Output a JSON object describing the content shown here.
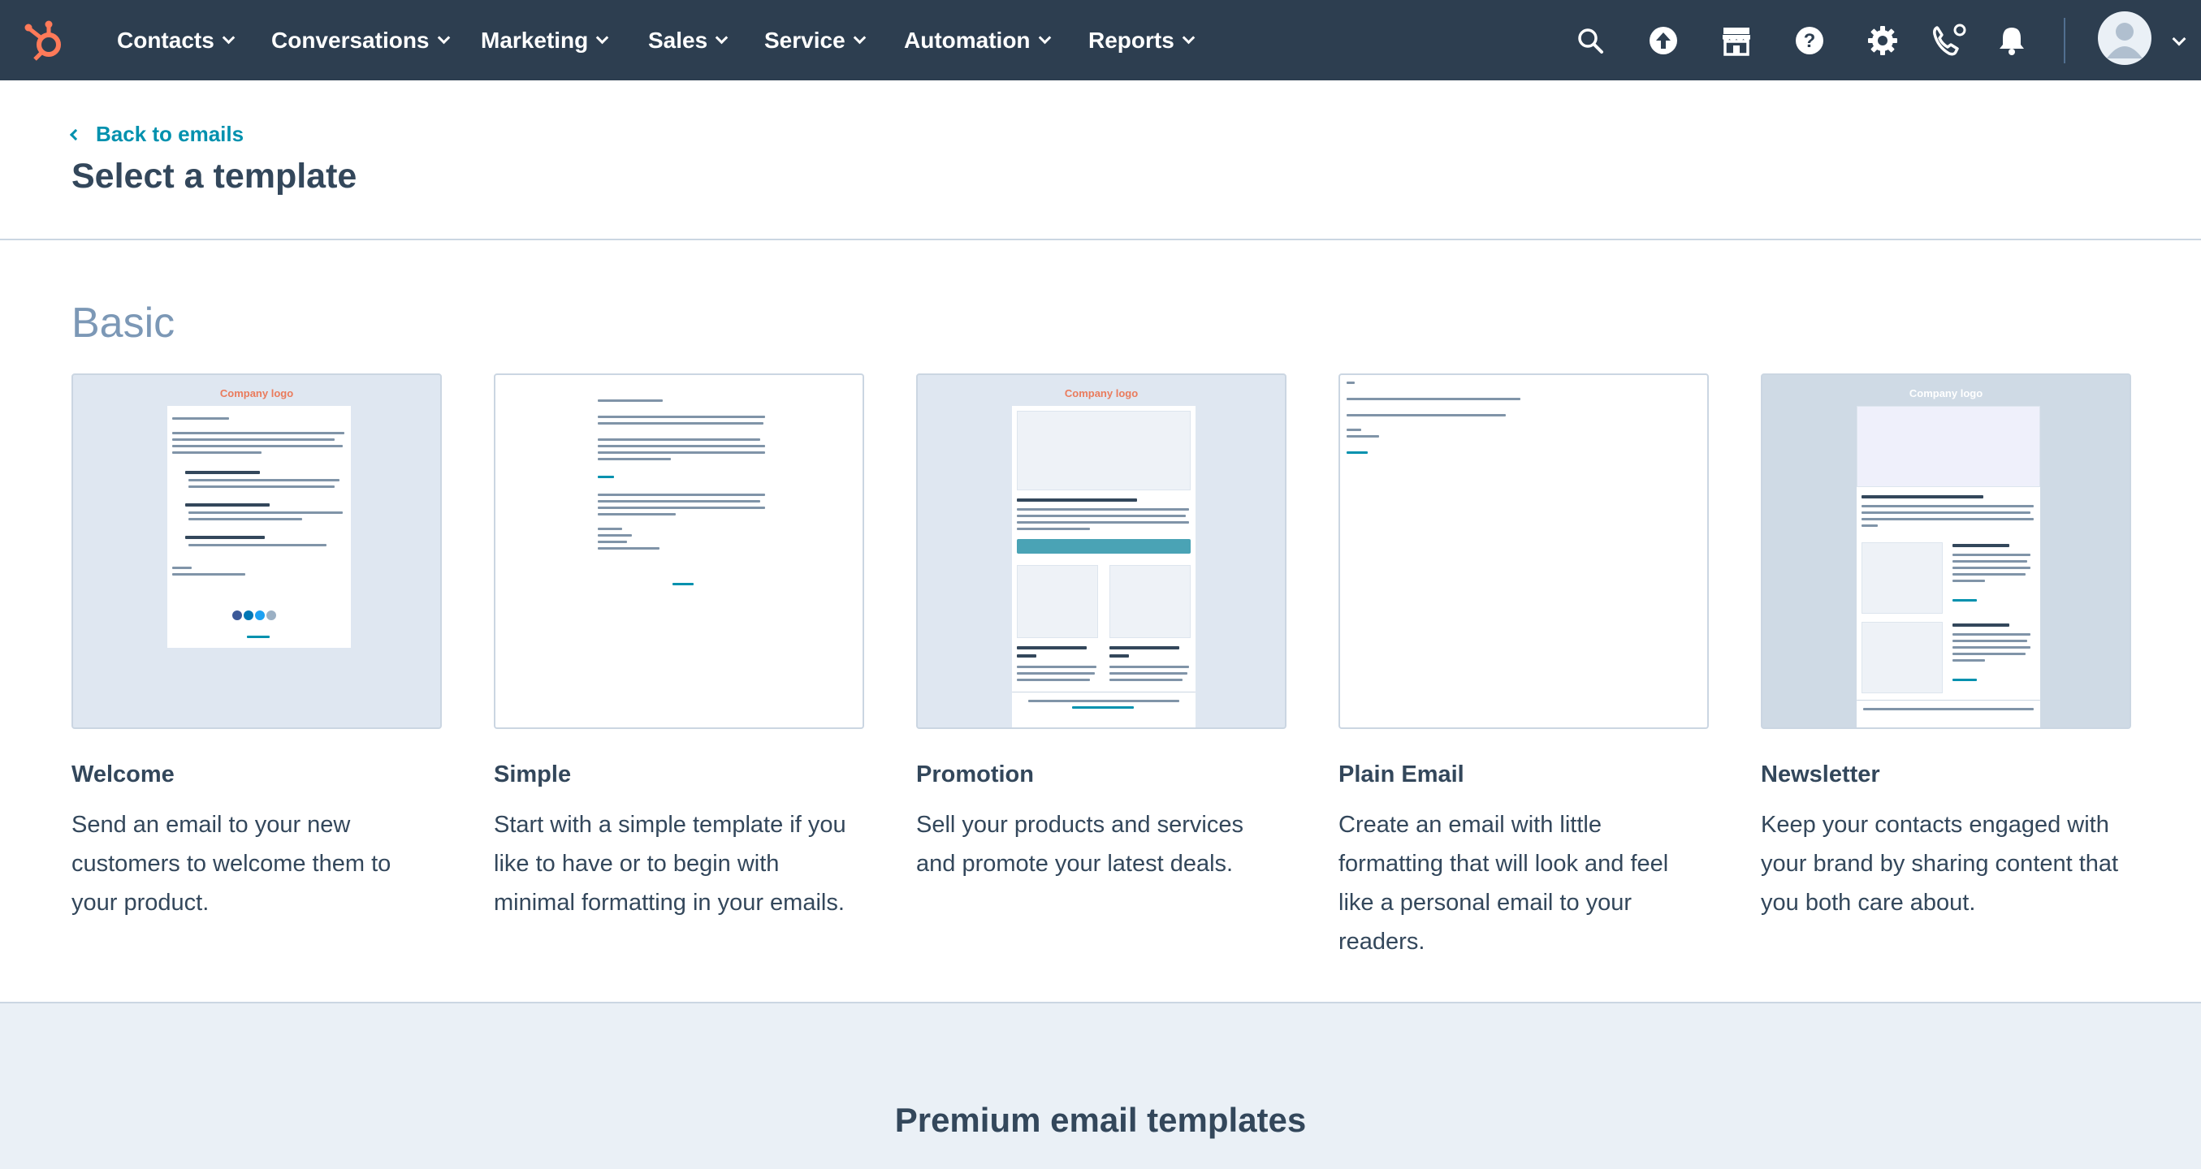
{
  "nav": {
    "items": [
      {
        "label": "Contacts"
      },
      {
        "label": "Conversations"
      },
      {
        "label": "Marketing"
      },
      {
        "label": "Sales"
      },
      {
        "label": "Service"
      },
      {
        "label": "Automation"
      },
      {
        "label": "Reports"
      }
    ],
    "icons": [
      "search-icon",
      "upgrade-icon",
      "marketplace-icon",
      "help-icon",
      "settings-icon",
      "calling-icon",
      "notifications-icon"
    ]
  },
  "header": {
    "back_label": "Back to emails",
    "title": "Select a template"
  },
  "basic": {
    "title": "Basic",
    "templates": [
      {
        "name": "Welcome",
        "description": "Send an email to your new customers to welcome them to your product.",
        "thumb_logo": "Company logo"
      },
      {
        "name": "Simple",
        "description": "Start with a simple template if you like to have or to begin with minimal formatting in your emails.",
        "thumb_logo": ""
      },
      {
        "name": "Promotion",
        "description": "Sell your products and services and promote your latest deals.",
        "thumb_logo": "Company logo"
      },
      {
        "name": "Plain Email",
        "description": "Create an email with little formatting that will look and feel like a personal email to your readers.",
        "thumb_logo": ""
      },
      {
        "name": "Newsletter",
        "description": "Keep your contacts engaged with your brand by sharing content that you both care about.",
        "thumb_logo": "Company logo"
      }
    ]
  },
  "premium": {
    "title": "Premium email templates"
  },
  "colors": {
    "nav_bg": "#2d3e50",
    "accent": "#0091ae",
    "brand": "#ff7a59",
    "text": "#33475b",
    "muted": "#7c98b6"
  }
}
